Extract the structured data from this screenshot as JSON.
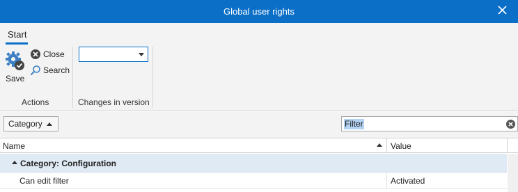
{
  "window": {
    "title": "Global user rights",
    "close_icon": "close-icon"
  },
  "ribbon": {
    "tab_start": "Start",
    "save_label": "Save",
    "close_label": "Close",
    "search_label": "Search",
    "group_actions": "Actions",
    "group_changes": "Changes in version",
    "version_selected": ""
  },
  "toolbar": {
    "category_button": "Category",
    "filter_value": "Filter"
  },
  "grid": {
    "columns": [
      "Name",
      "Value"
    ],
    "groups": [
      {
        "label": "Category: Configuration",
        "rows": [
          {
            "name": "Can edit filter",
            "value": "Activated"
          }
        ]
      }
    ]
  },
  "colors": {
    "accent": "#0b6fc7",
    "group_row_bg": "#dfeaf5",
    "ribbon_bg": "#f3f3f3"
  }
}
